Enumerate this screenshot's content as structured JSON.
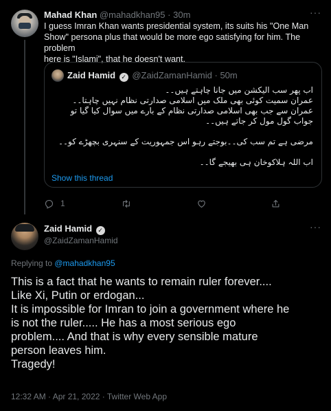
{
  "reply_tweet": {
    "author_name": "Mahad Khan",
    "handle": "@mahadkhan95",
    "separator": "·",
    "time": "30m",
    "body_lines": [
      "I guess Imran Khan wants presidential system, its suits his \"One Man",
      "Show\" persona plus that would be more ego satisfying for him. The problem",
      "here is \"Islami\", that he doesn't want."
    ],
    "more_label": "···",
    "quoted": {
      "author_name": "Zaid Hamid",
      "verified_icon": "verified-badge-icon",
      "handle": "@ZaidZamanHamid",
      "separator": "·",
      "time": "50m",
      "lines": [
        "اب پھر سب الیکشن میں جانا چاہتے ہیں۔۔",
        "عمران سمیت کوئی بھی ملک میں اسلامی صدارتی نظام نہیں چاہتا۔۔",
        "عمران سے جب بھی اسلامی صدارتی نظام کے بارے میں سوال کیا گیا تو",
        "جواب گول مول کر جاتے ہیں۔۔",
        "",
        "مرضی ہے تم سب کی۔۔بوجتے رہو اس جمہوریت کے سنہری بچھڑے کو۔۔",
        "",
        "اب اللہ ہلاکوخان ہی بھیجے گا۔۔"
      ],
      "show_thread_label": "Show this thread"
    },
    "actions": {
      "reply_icon": "reply-icon",
      "reply_count": "1",
      "retweet_icon": "retweet-icon",
      "like_icon": "heart-icon",
      "share_icon": "share-icon"
    }
  },
  "main_tweet": {
    "author_name": "Zaid Hamid",
    "verified_icon": "verified-badge-icon",
    "handle": "@ZaidZamanHamid",
    "more_label": "···",
    "replying_prefix": "Replying to ",
    "replying_mention": "@mahadkhan95",
    "body_lines": [
      "This is a fact that he wants to remain ruler forever....",
      "Like Xi, Putin or erdogan...",
      "It is impossible for Imran to join a government where he",
      "is not the ruler..... He has a most serious ego",
      "problem.... And that is why every sensible mature",
      "person leaves him.",
      "Tragedy!"
    ],
    "timestamp": "12:32 AM · Apr 21, 2022 · Twitter Web App"
  },
  "colors": {
    "background": "#000000",
    "text": "#e7e9ea",
    "secondary": "#71767b",
    "accent": "#1d9bf0",
    "border": "#2f3336"
  }
}
